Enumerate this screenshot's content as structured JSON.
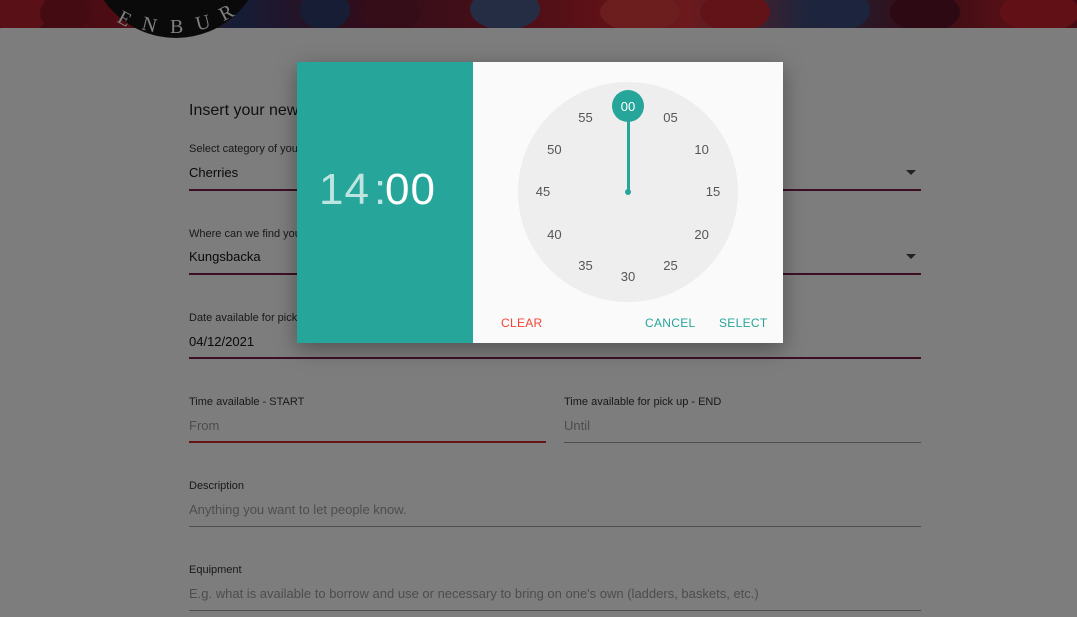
{
  "logo": {
    "letters": [
      "E",
      "N",
      "B",
      "U",
      "R"
    ]
  },
  "form": {
    "heading": "Insert your new",
    "category": {
      "label": "Select category of your",
      "value": "Cherries"
    },
    "location": {
      "label": "Where can we find you",
      "value": "Kungsbacka"
    },
    "date": {
      "label": "Date available for pick",
      "value": "04/12/2021"
    },
    "time_start": {
      "label": "Time available - START",
      "placeholder": "From"
    },
    "time_end": {
      "label": "Time available for pick up - END",
      "placeholder": "Until"
    },
    "description": {
      "label": "Description",
      "placeholder": "Anything you want to let people know."
    },
    "equipment": {
      "label": "Equipment",
      "placeholder": "E.g. what is available to borrow and use or necessary to bring on one's own (ladders, baskets, etc.)"
    }
  },
  "timepicker": {
    "hours": "14",
    "separator": ":",
    "minutes": "00",
    "clock_numbers": [
      "00",
      "05",
      "10",
      "15",
      "20",
      "25",
      "30",
      "35",
      "40",
      "45",
      "50",
      "55"
    ],
    "selected_minute": "00",
    "buttons": {
      "clear": "CLEAR",
      "cancel": "CANCEL",
      "select": "SELECT"
    }
  },
  "colors": {
    "accent": "#26a69a",
    "danger": "#f44336",
    "underline_active": "#c62828",
    "underline_select": "#7b1fa2"
  }
}
